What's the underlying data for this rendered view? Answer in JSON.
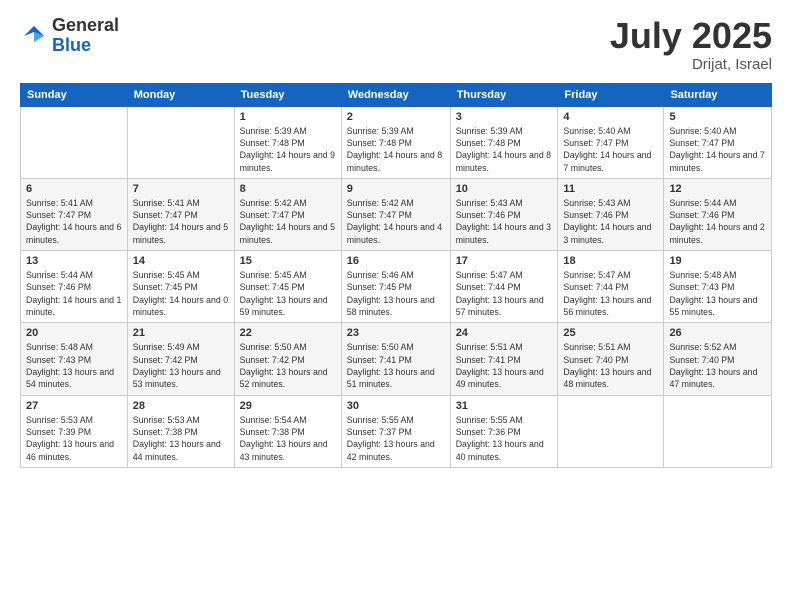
{
  "logo": {
    "general": "General",
    "blue": "Blue"
  },
  "header": {
    "month_year": "July 2025",
    "location": "Drijat, Israel"
  },
  "days_of_week": [
    "Sunday",
    "Monday",
    "Tuesday",
    "Wednesday",
    "Thursday",
    "Friday",
    "Saturday"
  ],
  "weeks": [
    [
      {
        "day": "",
        "info": ""
      },
      {
        "day": "",
        "info": ""
      },
      {
        "day": "1",
        "info": "Sunrise: 5:39 AM\nSunset: 7:48 PM\nDaylight: 14 hours and 9 minutes."
      },
      {
        "day": "2",
        "info": "Sunrise: 5:39 AM\nSunset: 7:48 PM\nDaylight: 14 hours and 8 minutes."
      },
      {
        "day": "3",
        "info": "Sunrise: 5:39 AM\nSunset: 7:48 PM\nDaylight: 14 hours and 8 minutes."
      },
      {
        "day": "4",
        "info": "Sunrise: 5:40 AM\nSunset: 7:47 PM\nDaylight: 14 hours and 7 minutes."
      },
      {
        "day": "5",
        "info": "Sunrise: 5:40 AM\nSunset: 7:47 PM\nDaylight: 14 hours and 7 minutes."
      }
    ],
    [
      {
        "day": "6",
        "info": "Sunrise: 5:41 AM\nSunset: 7:47 PM\nDaylight: 14 hours and 6 minutes."
      },
      {
        "day": "7",
        "info": "Sunrise: 5:41 AM\nSunset: 7:47 PM\nDaylight: 14 hours and 5 minutes."
      },
      {
        "day": "8",
        "info": "Sunrise: 5:42 AM\nSunset: 7:47 PM\nDaylight: 14 hours and 5 minutes."
      },
      {
        "day": "9",
        "info": "Sunrise: 5:42 AM\nSunset: 7:47 PM\nDaylight: 14 hours and 4 minutes."
      },
      {
        "day": "10",
        "info": "Sunrise: 5:43 AM\nSunset: 7:46 PM\nDaylight: 14 hours and 3 minutes."
      },
      {
        "day": "11",
        "info": "Sunrise: 5:43 AM\nSunset: 7:46 PM\nDaylight: 14 hours and 3 minutes."
      },
      {
        "day": "12",
        "info": "Sunrise: 5:44 AM\nSunset: 7:46 PM\nDaylight: 14 hours and 2 minutes."
      }
    ],
    [
      {
        "day": "13",
        "info": "Sunrise: 5:44 AM\nSunset: 7:46 PM\nDaylight: 14 hours and 1 minute."
      },
      {
        "day": "14",
        "info": "Sunrise: 5:45 AM\nSunset: 7:45 PM\nDaylight: 14 hours and 0 minutes."
      },
      {
        "day": "15",
        "info": "Sunrise: 5:45 AM\nSunset: 7:45 PM\nDaylight: 13 hours and 59 minutes."
      },
      {
        "day": "16",
        "info": "Sunrise: 5:46 AM\nSunset: 7:45 PM\nDaylight: 13 hours and 58 minutes."
      },
      {
        "day": "17",
        "info": "Sunrise: 5:47 AM\nSunset: 7:44 PM\nDaylight: 13 hours and 57 minutes."
      },
      {
        "day": "18",
        "info": "Sunrise: 5:47 AM\nSunset: 7:44 PM\nDaylight: 13 hours and 56 minutes."
      },
      {
        "day": "19",
        "info": "Sunrise: 5:48 AM\nSunset: 7:43 PM\nDaylight: 13 hours and 55 minutes."
      }
    ],
    [
      {
        "day": "20",
        "info": "Sunrise: 5:48 AM\nSunset: 7:43 PM\nDaylight: 13 hours and 54 minutes."
      },
      {
        "day": "21",
        "info": "Sunrise: 5:49 AM\nSunset: 7:42 PM\nDaylight: 13 hours and 53 minutes."
      },
      {
        "day": "22",
        "info": "Sunrise: 5:50 AM\nSunset: 7:42 PM\nDaylight: 13 hours and 52 minutes."
      },
      {
        "day": "23",
        "info": "Sunrise: 5:50 AM\nSunset: 7:41 PM\nDaylight: 13 hours and 51 minutes."
      },
      {
        "day": "24",
        "info": "Sunrise: 5:51 AM\nSunset: 7:41 PM\nDaylight: 13 hours and 49 minutes."
      },
      {
        "day": "25",
        "info": "Sunrise: 5:51 AM\nSunset: 7:40 PM\nDaylight: 13 hours and 48 minutes."
      },
      {
        "day": "26",
        "info": "Sunrise: 5:52 AM\nSunset: 7:40 PM\nDaylight: 13 hours and 47 minutes."
      }
    ],
    [
      {
        "day": "27",
        "info": "Sunrise: 5:53 AM\nSunset: 7:39 PM\nDaylight: 13 hours and 46 minutes."
      },
      {
        "day": "28",
        "info": "Sunrise: 5:53 AM\nSunset: 7:38 PM\nDaylight: 13 hours and 44 minutes."
      },
      {
        "day": "29",
        "info": "Sunrise: 5:54 AM\nSunset: 7:38 PM\nDaylight: 13 hours and 43 minutes."
      },
      {
        "day": "30",
        "info": "Sunrise: 5:55 AM\nSunset: 7:37 PM\nDaylight: 13 hours and 42 minutes."
      },
      {
        "day": "31",
        "info": "Sunrise: 5:55 AM\nSunset: 7:36 PM\nDaylight: 13 hours and 40 minutes."
      },
      {
        "day": "",
        "info": ""
      },
      {
        "day": "",
        "info": ""
      }
    ]
  ]
}
